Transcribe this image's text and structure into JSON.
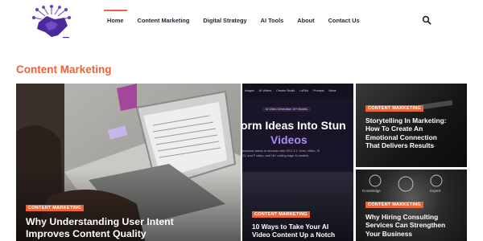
{
  "nav": {
    "items": [
      {
        "label": "Home",
        "active": true
      },
      {
        "label": "Content Marketing",
        "active": false
      },
      {
        "label": "Digital Strategy",
        "active": false
      },
      {
        "label": "AI Tools",
        "active": false
      },
      {
        "label": "About",
        "active": false
      },
      {
        "label": "Contact Us",
        "active": false
      }
    ],
    "search_icon": "search-icon"
  },
  "logo_icon": "handshake-network-logo",
  "section": {
    "title": "Content Marketing"
  },
  "posts": [
    {
      "category": "Content Marketing",
      "title_line1": "Why Understanding User Intent",
      "title_line2": "Improves Content Quality"
    },
    {
      "category": "Content Marketing",
      "title_line1": "10 Ways to Take Your AI",
      "title_line2": "Video Content Up a Notch",
      "screen": {
        "menu": [
          "Images",
          "AI Videos",
          "Creator Studio",
          "LoRAs",
          "Prompts",
          "News"
        ],
        "pill": "AI Video Generation 15+ Models",
        "headline1": "orm Ideas Into Stun",
        "headline2": "Videos",
        "sub1": "essional videos in seconds with VEO 3.1, Dreb, Video, Sl",
        "sub2": "1V, and P video, and 18+ cutting-edge AI models."
      }
    },
    {
      "category": "Content Marketing",
      "title_line1": "Storytelling In Marketing:",
      "title_line2": "How To Create An",
      "title_line3": "Emotional Connection",
      "title_line4": "That Delivers Results"
    },
    {
      "category": "Content Marketing",
      "title_line1": "Why Hiring Consulting",
      "title_line2": "Services Can Strengthen",
      "title_line3": "Your Business",
      "labels": [
        "Knowledge",
        "Expert"
      ]
    }
  ],
  "colors": {
    "accent": "#e8653a",
    "nav_text": "#1d2433",
    "logo_purple": "#4b2a9c"
  }
}
